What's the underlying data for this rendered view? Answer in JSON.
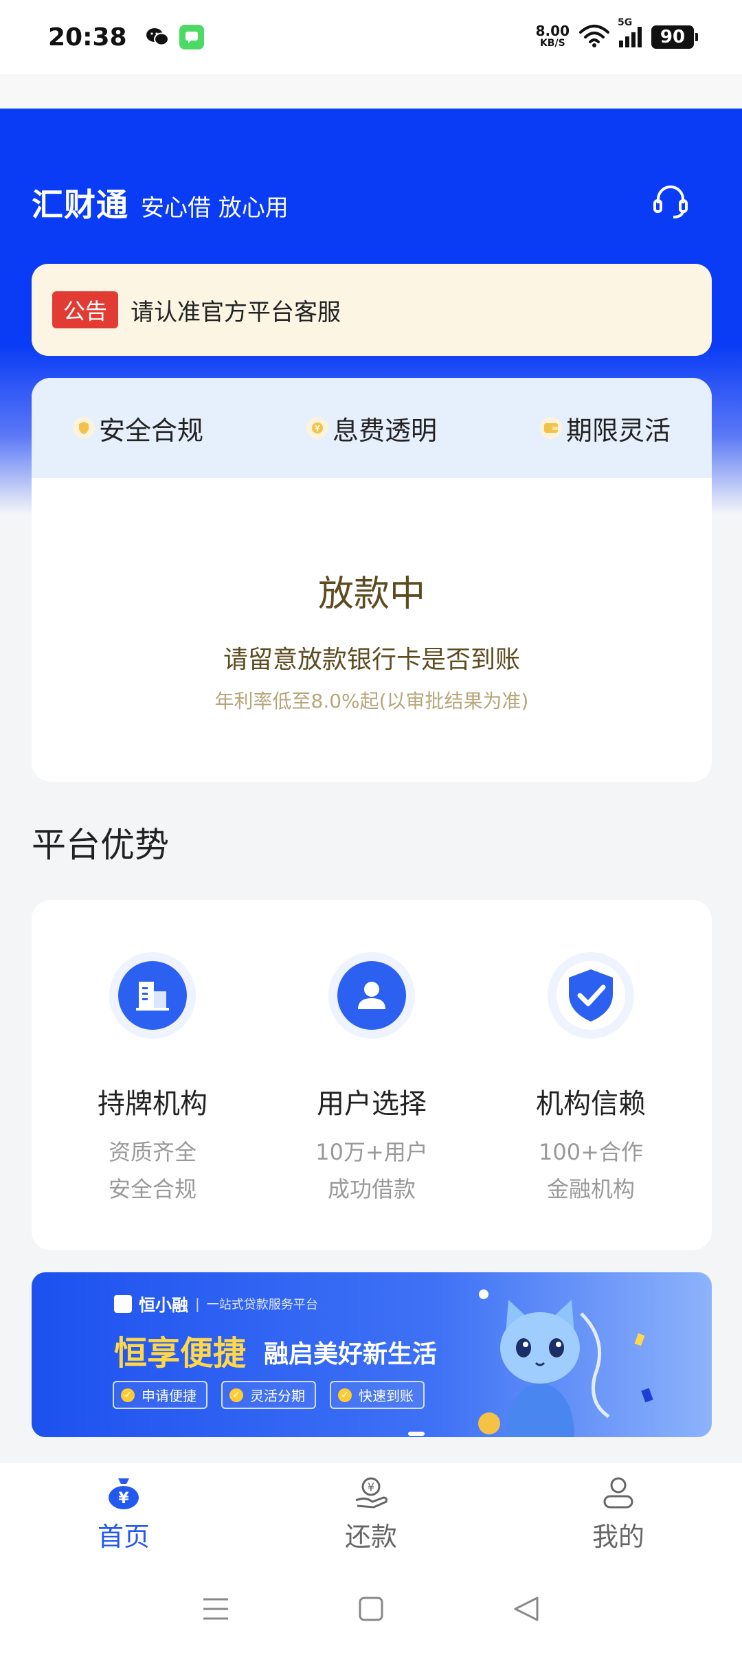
{
  "status_bar": {
    "time": "20:38",
    "net_speed": "8.00",
    "net_unit": "KB/S",
    "signal_label": "5G",
    "battery": "90"
  },
  "header": {
    "brand": "汇财通",
    "slogan": "安心借 放心用"
  },
  "notice": {
    "badge": "公告",
    "text": "请认准官方平台客服"
  },
  "features": [
    {
      "label": "安全合规",
      "icon": "shield-icon"
    },
    {
      "label": "息费透明",
      "icon": "coin-icon"
    },
    {
      "label": "期限灵活",
      "icon": "wallet-icon"
    }
  ],
  "loan_status": {
    "title": "放款中",
    "subtitle": "请留意放款银行卡是否到账",
    "rate_note": "年利率低至8.0%起(以审批结果为准)"
  },
  "advantages": {
    "title": "平台优势",
    "items": [
      {
        "title": "持牌机构",
        "desc1": "资质齐全",
        "desc2": "安全合规",
        "icon": "building-icon"
      },
      {
        "title": "用户选择",
        "desc1": "10万+用户",
        "desc2": "成功借款",
        "icon": "user-icon"
      },
      {
        "title": "机构信赖",
        "desc1": "100+合作",
        "desc2": "金融机构",
        "icon": "shield-check-icon"
      }
    ]
  },
  "banner": {
    "brand": "恒小融",
    "tagline": "一站式贷款服务平台",
    "headline": "恒享便捷",
    "subline": "融启美好新生活",
    "chips": [
      "申请便捷",
      "灵活分期",
      "快速到账"
    ]
  },
  "bottom_nav": [
    {
      "label": "首页",
      "active": true,
      "icon": "home-moneybag-icon"
    },
    {
      "label": "还款",
      "active": false,
      "icon": "repay-icon"
    },
    {
      "label": "我的",
      "active": false,
      "icon": "profile-icon"
    }
  ],
  "colors": {
    "primary": "#2359ef",
    "hero": "#0a3cf5",
    "notice_bg": "#fcf5e4",
    "badge_red": "#e23b34",
    "status_brown": "#5e4c21"
  }
}
